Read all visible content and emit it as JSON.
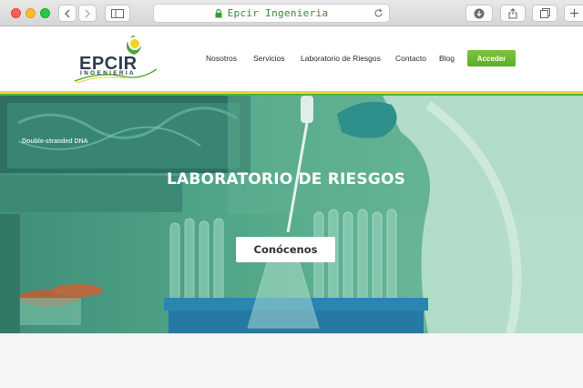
{
  "browser": {
    "url": "Epcir Ingenieria",
    "buttons": [
      "back-icon",
      "forward-icon",
      "sidebar-icon",
      "lock-icon",
      "reload-icon",
      "download-icon",
      "share-icon",
      "tabs-icon",
      "new-tab-icon"
    ]
  },
  "logo": {
    "main": "EPCIR",
    "sub": "INGENIERIA"
  },
  "nav": {
    "items": [
      {
        "label": "Nosotros"
      },
      {
        "label": "Servicios"
      },
      {
        "label": "Laboratorio de Riesgos"
      },
      {
        "label": "Contacto"
      },
      {
        "label": "Blog"
      }
    ],
    "cta": "Acceder"
  },
  "hero": {
    "title": "LABORATORIO DE RIESGOS",
    "button": "Conócenos",
    "image_text": {
      "line1": "Double-stranded DNA"
    }
  },
  "colors": {
    "accent_green": "#5eac2a",
    "stripe_yellow": "#e8d53a",
    "hero_tint": "#54a989"
  }
}
